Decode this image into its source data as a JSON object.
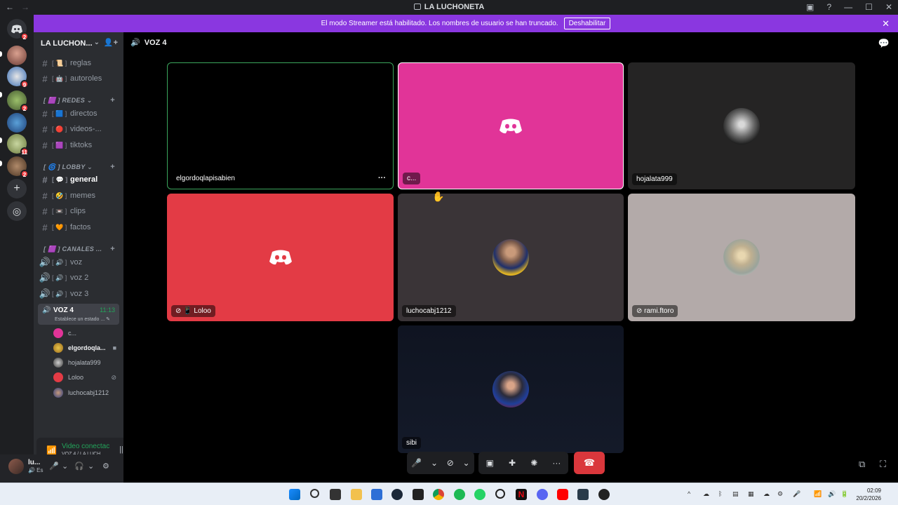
{
  "window": {
    "title": "LA LUCHONETA",
    "nav_back": "←",
    "nav_fwd": "→",
    "controls": [
      "▣",
      "?",
      "—",
      "☐",
      "✕"
    ]
  },
  "banner": {
    "text": "El modo Streamer está habilitado. Los nombres de usuario se han truncado.",
    "button": "Deshabilitar",
    "close": "✕"
  },
  "rail": {
    "badges": [
      "2",
      "9",
      "2",
      "11",
      "2"
    ],
    "add_icon": "+",
    "discover_icon": "◎"
  },
  "server": {
    "name": "LA LUCHON...",
    "chevron": "⌄",
    "invite_icon": "👤+"
  },
  "channels": {
    "top": [
      {
        "emoji": "[ 📜 ]",
        "name": "reglas"
      },
      {
        "emoji": "[ 🤖 ]",
        "name": "autoroles"
      }
    ],
    "cat_redes": "[ 🟪 ] REDES ⌄",
    "redes": [
      {
        "emoji": "[ 🟦 ]",
        "name": "directos"
      },
      {
        "emoji": "[ 🔴 ]",
        "name": "videos-..."
      },
      {
        "emoji": "[ 🟪 ]",
        "name": "tiktoks"
      }
    ],
    "cat_lobby": "[ 🌀 ] LOBBY ⌄",
    "lobby": [
      {
        "emoji": "[ 💬 ]",
        "name": "general"
      },
      {
        "emoji": "[ 🤣 ]",
        "name": "memes"
      },
      {
        "emoji": "[ 📼 ]",
        "name": "clips"
      },
      {
        "emoji": "[ 🧡 ]",
        "name": "factos"
      }
    ],
    "cat_canales": "[ 🟪 ] CANALES ...",
    "voice": [
      {
        "emoji": "[ 🔊 ]",
        "name": "voz"
      },
      {
        "emoji": "[ 🔊 ]",
        "name": "voz 2"
      },
      {
        "emoji": "[ 🔊 ]",
        "name": "voz 3"
      }
    ],
    "active_voice": {
      "name": "VOZ 4",
      "time": "11:13",
      "status": "Establece un estado ... ✎"
    },
    "members": [
      {
        "name": "c...",
        "right": ""
      },
      {
        "name": "elgordoqla...",
        "right": "■"
      },
      {
        "name": "hojalata999",
        "right": ""
      },
      {
        "name": "Loloo",
        "right": "⊘"
      },
      {
        "name": "luchocabj1212",
        "right": ""
      }
    ],
    "plus": "+"
  },
  "voice_panel": {
    "status": "Video conectac",
    "sub": "VOZ 4 / LA LUCH...",
    "signal_icon": "📶",
    "wave_icon": "|||",
    "disconnect_icon": "☎",
    "actions": [
      "⊘",
      "▣",
      "✚",
      "✺"
    ]
  },
  "user": {
    "name": "lu...",
    "status": "🔊 Es",
    "icons": [
      "🎤",
      "⌄",
      "🎧",
      "⌄",
      "⚙"
    ]
  },
  "call": {
    "channel": "VOZ 4",
    "speaker_icon": "🔊",
    "chat_icon": "💬",
    "tiles": [
      {
        "label": "elgordoqlapisabien",
        "more": "···"
      },
      {
        "label": "c..."
      },
      {
        "label": "hojalata999"
      },
      {
        "label": "⊘ 📱 Loloo"
      },
      {
        "label": "luchocabj1212"
      },
      {
        "label": "⊘ rami.ftoro"
      },
      {
        "label": "sibi"
      }
    ],
    "controls": {
      "mic": "🎤",
      "chev": "⌄",
      "cam": "⊘",
      "screen": "▣",
      "activities": "✚",
      "soundboard": "✺",
      "more": "···",
      "hangup": "☎"
    },
    "popout_icon": "⧉",
    "fullscreen_icon": "⛶"
  },
  "taskbar": {
    "clock_time": "02:09",
    "clock_date": "20/2/2026",
    "tray": [
      "^",
      "☁",
      "ᛒ",
      "▤",
      "▦",
      "☁",
      "⚙",
      "🎤",
      "📶",
      "🔊",
      "🔋"
    ]
  },
  "colors": {
    "accent_banner": "#8a37e0",
    "tile_pink": "#e13498",
    "tile_red": "#e33b45",
    "hangup": "#da373c",
    "connected": "#23a55a"
  }
}
